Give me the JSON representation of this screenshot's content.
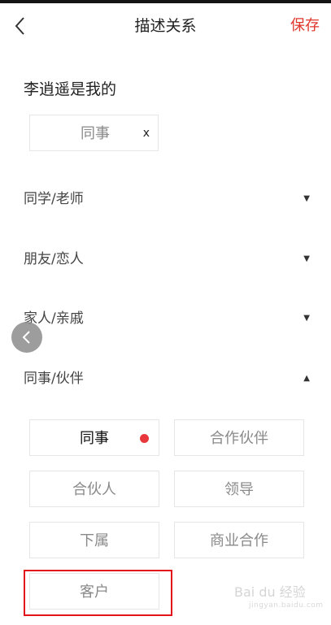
{
  "header": {
    "title": "描述关系",
    "save_label": "保存"
  },
  "prompt": "李逍遥是我的",
  "selected": {
    "label": "同事",
    "remove": "x"
  },
  "categories": [
    {
      "label": "同学/老师",
      "arrow": "▼"
    },
    {
      "label": "朋友/恋人",
      "arrow": "▼"
    },
    {
      "label": "家人/亲戚",
      "arrow": "▼"
    },
    {
      "label": "同事/伙伴",
      "arrow": "▲"
    }
  ],
  "tags": [
    {
      "label": "同事"
    },
    {
      "label": "合作伙伴"
    },
    {
      "label": "合伙人"
    },
    {
      "label": "领导"
    },
    {
      "label": "下属"
    },
    {
      "label": "商业合作"
    },
    {
      "label": "客户"
    }
  ],
  "watermark": {
    "brand": "Bai du 经验",
    "domain": "jingyan.baidu.com"
  },
  "colors": {
    "accent": "#e0352b",
    "dot": "#e8373a",
    "highlight": "#e3131b"
  }
}
